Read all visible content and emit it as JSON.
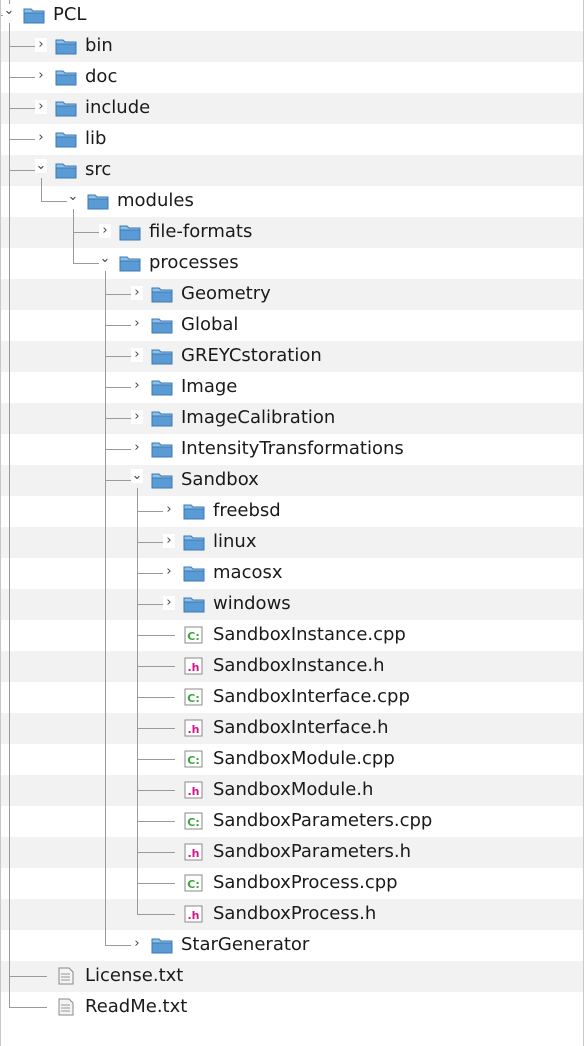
{
  "tree": {
    "nodes": [
      {
        "label": "PCL",
        "depth": 0,
        "type": "folder",
        "expanded": true
      },
      {
        "label": "bin",
        "depth": 1,
        "type": "folder",
        "expanded": false
      },
      {
        "label": "doc",
        "depth": 1,
        "type": "folder",
        "expanded": false
      },
      {
        "label": "include",
        "depth": 1,
        "type": "folder",
        "expanded": false
      },
      {
        "label": "lib",
        "depth": 1,
        "type": "folder",
        "expanded": false
      },
      {
        "label": "src",
        "depth": 1,
        "type": "folder",
        "expanded": true
      },
      {
        "label": "modules",
        "depth": 2,
        "type": "folder",
        "expanded": true
      },
      {
        "label": "file-formats",
        "depth": 3,
        "type": "folder",
        "expanded": false
      },
      {
        "label": "processes",
        "depth": 3,
        "type": "folder",
        "expanded": true
      },
      {
        "label": "Geometry",
        "depth": 4,
        "type": "folder",
        "expanded": false
      },
      {
        "label": "Global",
        "depth": 4,
        "type": "folder",
        "expanded": false
      },
      {
        "label": "GREYCstoration",
        "depth": 4,
        "type": "folder",
        "expanded": false
      },
      {
        "label": "Image",
        "depth": 4,
        "type": "folder",
        "expanded": false
      },
      {
        "label": "ImageCalibration",
        "depth": 4,
        "type": "folder",
        "expanded": false
      },
      {
        "label": "IntensityTransformations",
        "depth": 4,
        "type": "folder",
        "expanded": false
      },
      {
        "label": "Sandbox",
        "depth": 4,
        "type": "folder",
        "expanded": true
      },
      {
        "label": "freebsd",
        "depth": 5,
        "type": "folder",
        "expanded": false
      },
      {
        "label": "linux",
        "depth": 5,
        "type": "folder",
        "expanded": false
      },
      {
        "label": "macosx",
        "depth": 5,
        "type": "folder",
        "expanded": false
      },
      {
        "label": "windows",
        "depth": 5,
        "type": "folder",
        "expanded": false
      },
      {
        "label": "SandboxInstance.cpp",
        "depth": 5,
        "type": "cpp"
      },
      {
        "label": "SandboxInstance.h",
        "depth": 5,
        "type": "h"
      },
      {
        "label": "SandboxInterface.cpp",
        "depth": 5,
        "type": "cpp"
      },
      {
        "label": "SandboxInterface.h",
        "depth": 5,
        "type": "h"
      },
      {
        "label": "SandboxModule.cpp",
        "depth": 5,
        "type": "cpp"
      },
      {
        "label": "SandboxModule.h",
        "depth": 5,
        "type": "h"
      },
      {
        "label": "SandboxParameters.cpp",
        "depth": 5,
        "type": "cpp"
      },
      {
        "label": "SandboxParameters.h",
        "depth": 5,
        "type": "h"
      },
      {
        "label": "SandboxProcess.cpp",
        "depth": 5,
        "type": "cpp"
      },
      {
        "label": "SandboxProcess.h",
        "depth": 5,
        "type": "h"
      },
      {
        "label": "StarGenerator",
        "depth": 4,
        "type": "folder",
        "expanded": false
      },
      {
        "label": "License.txt",
        "depth": 1,
        "type": "txt"
      },
      {
        "label": "ReadMe.txt",
        "depth": 1,
        "type": "txt"
      }
    ],
    "twisty_glyphs": {
      "expanded": "⌄",
      "collapsed": "›"
    },
    "icon_names": {
      "folder": "folder-icon",
      "cpp": "cpp-file-icon",
      "h": "header-file-icon",
      "txt": "text-file-icon"
    },
    "badge_text": {
      "cpp": "C:",
      "h": ".h"
    },
    "colors": {
      "folder_body": "#5b9bd5",
      "folder_top": "#8cc0ea",
      "cpp_badge": "#3aa63a",
      "h_badge": "#d4148c",
      "tree_line": "#9a9a9a",
      "row_alt": "#f2f2f2"
    }
  }
}
